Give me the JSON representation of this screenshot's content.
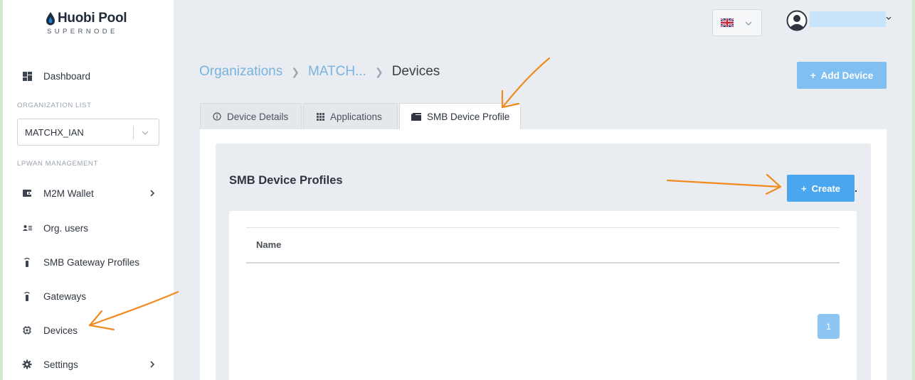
{
  "brand": {
    "name": "Huobi Pool",
    "tagline": "SUPERNODE"
  },
  "sidebar": {
    "dashboard": "Dashboard",
    "org_list_label": "ORGANIZATION LIST",
    "org_selected": "MATCHX_IAN",
    "lpwan_label": "LPWAN MANAGEMENT",
    "items": [
      {
        "label": "M2M Wallet",
        "icon": "wallet-icon",
        "has_submenu": true
      },
      {
        "label": "Org. users",
        "icon": "users-icon",
        "has_submenu": false
      },
      {
        "label": "SMB Gateway Profiles",
        "icon": "gateway-icon",
        "has_submenu": false
      },
      {
        "label": "Gateways",
        "icon": "gateway-icon",
        "has_submenu": false
      },
      {
        "label": "Devices",
        "icon": "chip-icon",
        "has_submenu": false
      },
      {
        "label": "Settings",
        "icon": "gear-icon",
        "has_submenu": true
      }
    ]
  },
  "header": {
    "language_flag": "uk-flag-icon",
    "user_name": ""
  },
  "breadcrumb": {
    "items": [
      "Organizations",
      "MATCH...",
      "Devices"
    ]
  },
  "actions": {
    "add_device": "Add Device"
  },
  "tabs": [
    {
      "label": "Device Details",
      "icon": "info-icon",
      "active": false
    },
    {
      "label": "Applications",
      "icon": "grid-icon",
      "active": false
    },
    {
      "label": "SMB Device Profile",
      "icon": "folder-icon",
      "active": true
    }
  ],
  "panel": {
    "title": "SMB Device Profiles",
    "create_label": "Create",
    "table": {
      "columns": [
        "Name"
      ],
      "rows": []
    },
    "pagination": {
      "current_page": "1"
    }
  },
  "colors": {
    "accent": "#4aa6ee",
    "accent_light": "#7fbff2",
    "link": "#7ab3e0",
    "annotation": "#f28a1e"
  }
}
